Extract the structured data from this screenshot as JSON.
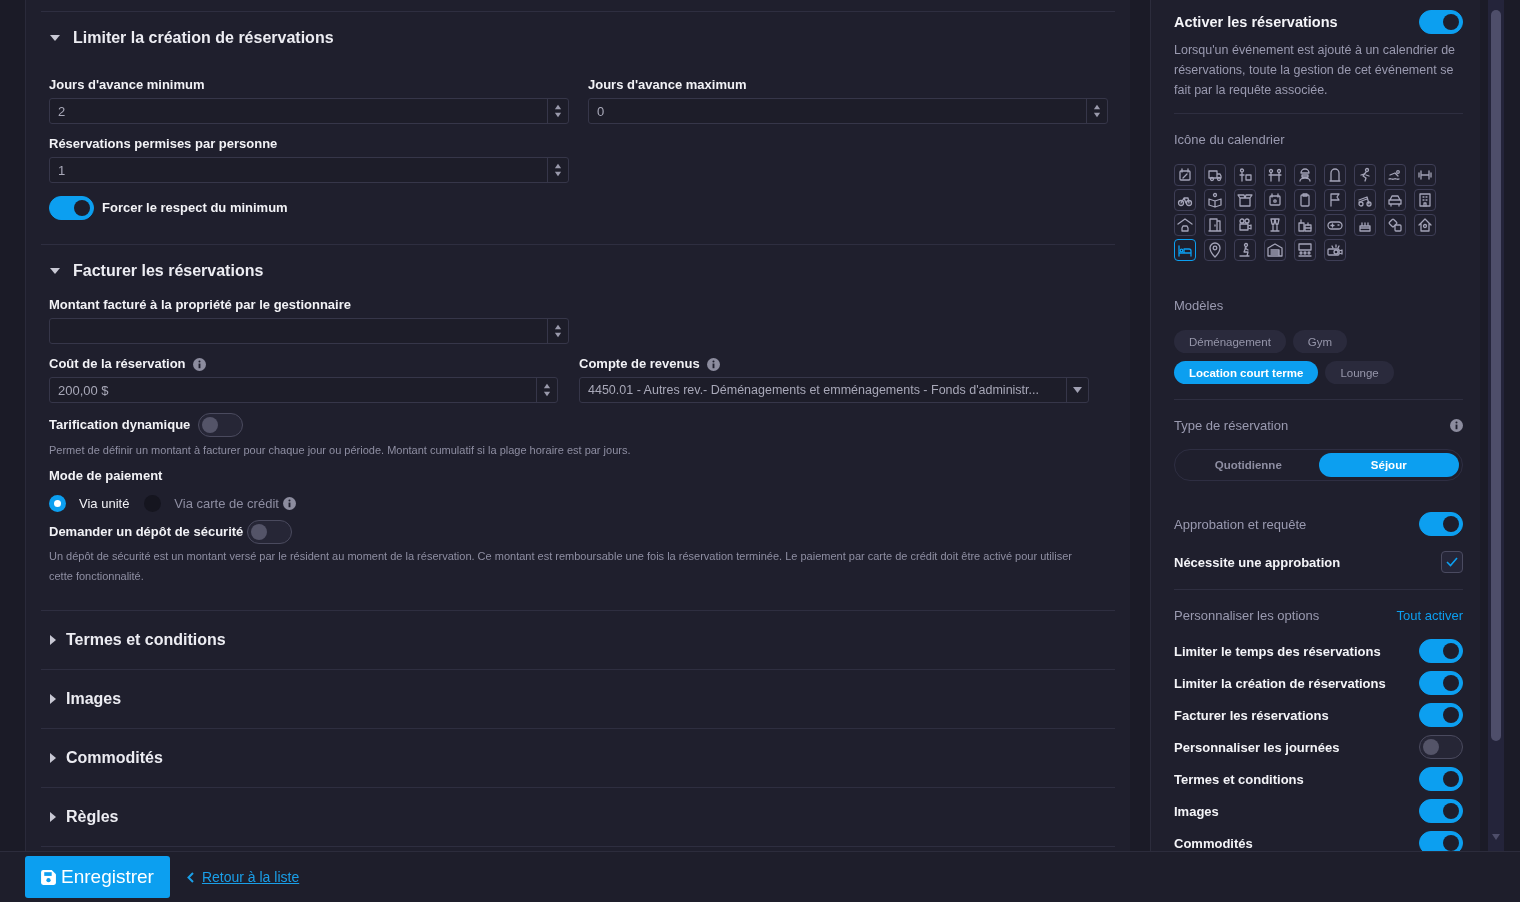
{
  "sections": [
    {
      "kind": "limits",
      "title": "Limiter la création de réservations",
      "expanded": true,
      "min_days": {
        "label": "Jours d'avance minimum",
        "value": "2"
      },
      "max_days": {
        "label": "Jours d'avance maximum",
        "value": "0"
      },
      "per_person": {
        "label": "Réservations permises par personne",
        "value": "1"
      },
      "force_minimum": {
        "label": "Forcer le respect du minimum",
        "on": true
      }
    },
    {
      "kind": "billing",
      "title": "Facturer les réservations",
      "expanded": true,
      "billed_amount": {
        "label": "Montant facturé à la propriété par le gestionnaire"
      },
      "cost": {
        "label": "Coût de la réservation",
        "value": "200,00 $"
      },
      "revenue_account": {
        "label": "Compte de revenus",
        "value": "4450.01 - Autres rev.- Déménagements et emménagements - Fonds d'administr..."
      },
      "dynamic_pricing": {
        "label": "Tarification dynamique",
        "on": false,
        "help": "Permet de définir un montant à facturer pour chaque jour ou période. Montant cumulatif si la plage horaire est par jours."
      },
      "payment_mode": {
        "label": "Mode de paiement",
        "options": [
          {
            "label": "Via unité",
            "selected": true
          },
          {
            "label": "Via carte de crédit",
            "selected": false
          }
        ]
      },
      "security_deposit": {
        "label": "Demander un dépôt de sécurité",
        "on": false,
        "help": "Un dépôt de sécurité est un montant versé par le résident au moment de la réservation. Ce montant est remboursable une fois la réservation terminée. Le paiement par carte de crédit doit être activé pour utiliser cette fonctionnalité."
      }
    },
    {
      "title": "Termes et conditions",
      "expanded": false
    },
    {
      "title": "Images",
      "expanded": false
    },
    {
      "title": "Commodités",
      "expanded": false
    },
    {
      "title": "Règles",
      "expanded": false
    }
  ],
  "sidebar": {
    "activate": {
      "title": "Activer les réservations",
      "on": true,
      "description": "Lorsqu'un événement est ajouté à un calendrier de réservations, toute la gestion de cet événement se fait par la requête associée."
    },
    "calendar_icon": {
      "label": "Icône du calendrier",
      "icons": [
        {
          "selected": false
        },
        {
          "selected": false
        },
        {
          "selected": false
        },
        {
          "selected": false
        },
        {
          "selected": false
        },
        {
          "selected": false
        },
        {
          "selected": false
        },
        {
          "selected": false
        },
        {
          "selected": false
        },
        {
          "selected": false
        },
        {
          "selected": false
        },
        {
          "selected": false
        },
        {
          "selected": false
        },
        {
          "selected": false
        },
        {
          "selected": false
        },
        {
          "selected": false
        },
        {
          "selected": false
        },
        {
          "selected": false
        },
        {
          "selected": false
        },
        {
          "selected": false
        },
        {
          "selected": false
        },
        {
          "selected": false
        },
        {
          "selected": false
        },
        {
          "selected": false
        },
        {
          "selected": false
        },
        {
          "selected": false
        },
        {
          "selected": false
        },
        {
          "selected": true
        },
        {
          "selected": false
        },
        {
          "selected": false
        },
        {
          "selected": false
        },
        {
          "selected": false
        },
        {
          "selected": false
        }
      ]
    },
    "templates": {
      "label": "Modèles",
      "items": [
        {
          "label": "Déménagement",
          "selected": false
        },
        {
          "label": "Gym",
          "selected": false
        },
        {
          "label": "Location court terme",
          "selected": true
        },
        {
          "label": "Lounge",
          "selected": false
        }
      ]
    },
    "reservation_type": {
      "label": "Type de réservation",
      "options": [
        {
          "label": "Quotidienne",
          "selected": false
        },
        {
          "label": "Séjour",
          "selected": true
        }
      ]
    },
    "approval": {
      "label": "Approbation et requête",
      "on": true
    },
    "requires_approval": {
      "label": "Nécessite une approbation",
      "checked": true
    },
    "customize": {
      "label": "Personnaliser les options",
      "link": "Tout activer",
      "options": [
        {
          "label": "Limiter le temps des réservations",
          "on": true
        },
        {
          "label": "Limiter la création de réservations",
          "on": true
        },
        {
          "label": "Facturer les réservations",
          "on": true
        },
        {
          "label": "Personnaliser les journées",
          "on": false
        },
        {
          "label": "Termes et conditions",
          "on": true
        },
        {
          "label": "Images",
          "on": true
        },
        {
          "label": "Commodités",
          "on": true
        }
      ]
    }
  },
  "footer": {
    "save": "Enregistrer",
    "back": "Retour à la liste"
  }
}
